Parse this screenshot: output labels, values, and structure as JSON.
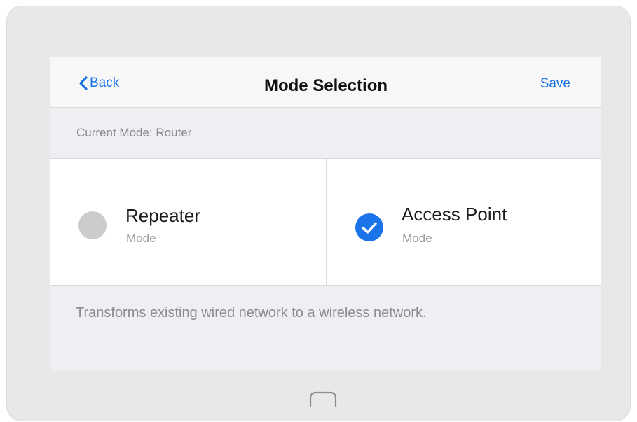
{
  "header": {
    "back_label": "Back",
    "title": "Mode Selection",
    "save_label": "Save"
  },
  "current_mode": {
    "text": "Current Mode: Router"
  },
  "options": [
    {
      "title": "Repeater",
      "subtitle": "Mode",
      "selected": false
    },
    {
      "title": "Access Point",
      "subtitle": "Mode",
      "selected": true
    }
  ],
  "description": "Transforms existing wired network to a wireless network.",
  "colors": {
    "accent": "#1a73e8",
    "radio_unselected": "#cccccc",
    "section_background": "#efeff3",
    "device_frame": "#e8e8e8"
  },
  "icons": {
    "back": "chevron-left-icon",
    "selected": "checkmark-circle-icon",
    "unselected": "empty-circle-icon",
    "home": "home-button-icon"
  }
}
